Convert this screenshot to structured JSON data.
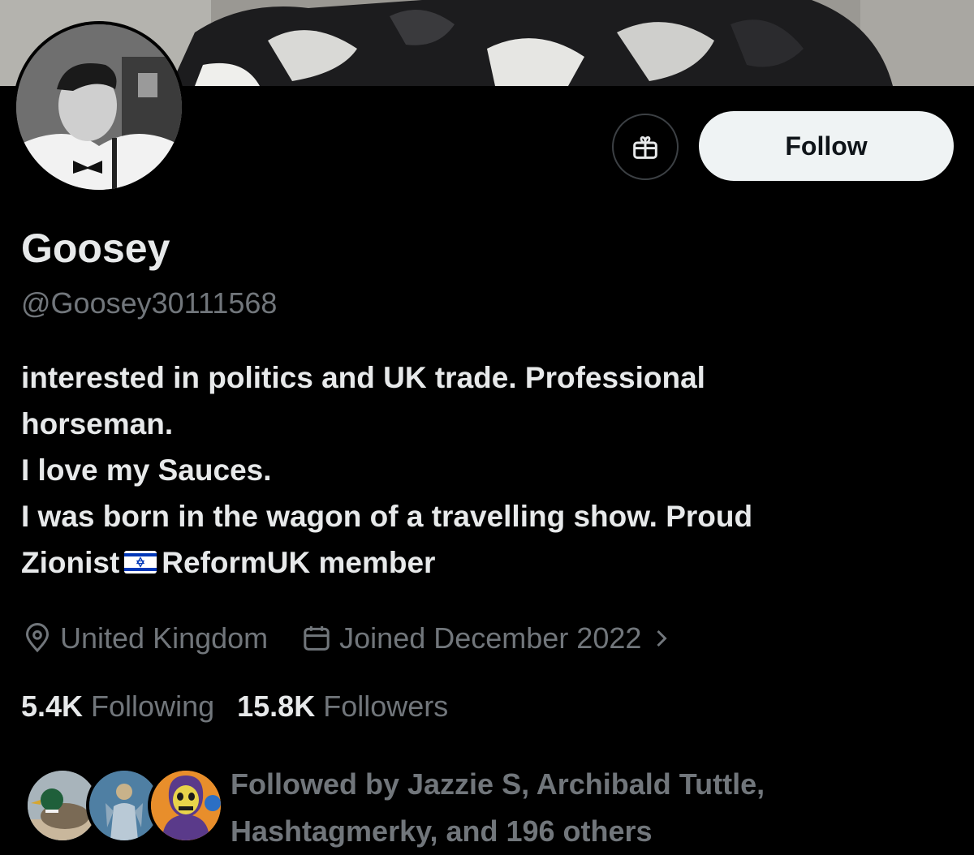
{
  "profile": {
    "display_name": "Goosey",
    "handle": "@Goosey30111568",
    "bio_lines": [
      "interested in politics and UK trade. Professional",
      "horseman.",
      "I love my Sauces.",
      "I was born in the wagon of a travelling show. Proud",
      "Zionist",
      "ReformUK member"
    ],
    "bio_emoji": "israel-flag",
    "location": "United Kingdom",
    "joined": "Joined December 2022",
    "following_count": "5.4K",
    "following_label": "Following",
    "followers_count": "15.8K",
    "followers_label": "Followers",
    "followed_by_line1": "Followed by Jazzie S, Archibald Tuttle,",
    "followed_by_line2": "Hashtagmerky, and 196 others"
  },
  "actions": {
    "follow_label": "Follow",
    "gift_icon": "gift-icon"
  },
  "icons": {
    "location": "location-pin-icon",
    "calendar": "calendar-icon",
    "chevron": "chevron-right-icon"
  },
  "colors": {
    "background": "#000000",
    "primary_text": "#e7e9ea",
    "secondary_text": "#71767b",
    "follow_button_bg": "#eff3f4",
    "follow_button_text": "#0f1419",
    "border": "#3c4044",
    "flag_blue": "#0038b8"
  }
}
